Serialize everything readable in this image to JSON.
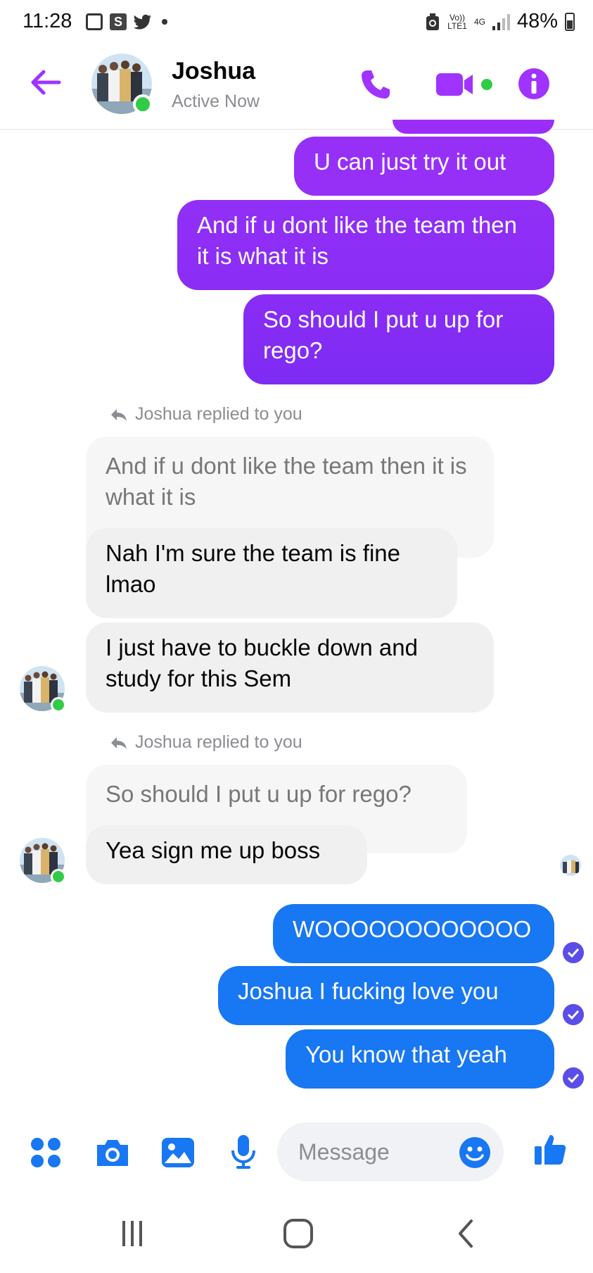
{
  "status_bar": {
    "time": "11:28",
    "network_top": "Vo))",
    "network_bottom": "LTE1",
    "net_type": "4G",
    "battery": "48%"
  },
  "header": {
    "contact_name": "Joshua",
    "status": "Active Now",
    "accent_color": "#a033ff"
  },
  "messages": {
    "sent_1": "U can just try it out",
    "sent_2": "And if u dont like the team then it is what it is",
    "sent_3": "So should I put u up for rego?",
    "reply_label_1": "Joshua replied to you",
    "quoted_1": "And if u dont like the team then it is what it is",
    "recv_1": "Nah I'm sure the team is fine lmao",
    "recv_2": "I just have to buckle down and study for this Sem",
    "reply_label_2": "Joshua replied to you",
    "quoted_2": "So should I put u up for rego?",
    "recv_3": "Yea sign me up boss",
    "sent_4": "WOOOOOOOOOOOO",
    "sent_5": "Joshua I fucking love you",
    "sent_6": "You know that yeah"
  },
  "composer": {
    "placeholder": "Message"
  },
  "colors": {
    "messenger_blue": "#1877f2",
    "purple_gradient_start": "#a033ff",
    "purple_gradient_end": "#7a2cf5"
  }
}
